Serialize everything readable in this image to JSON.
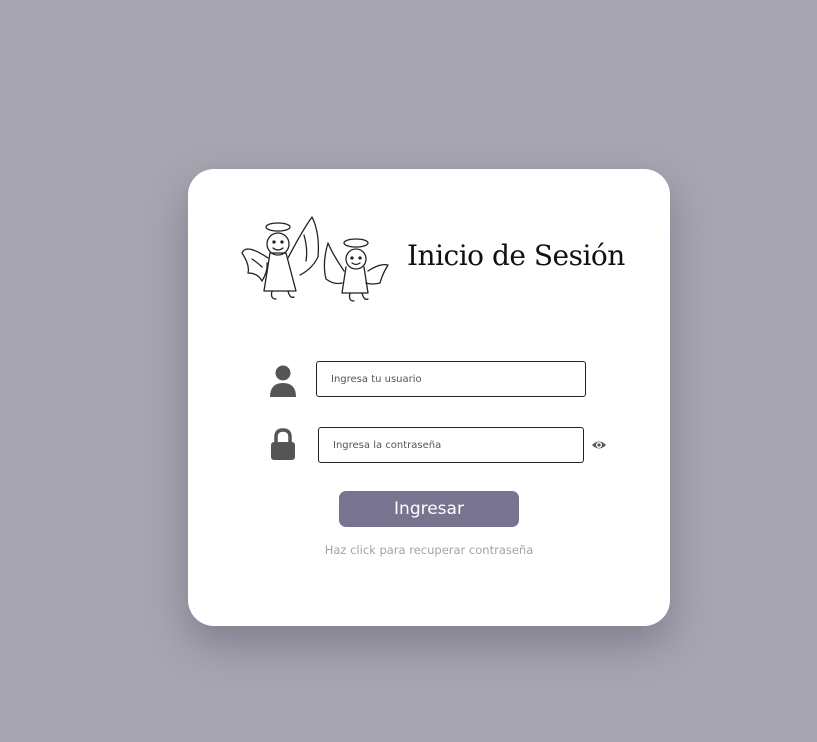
{
  "login": {
    "title": "Inicio de Sesión",
    "username_placeholder": "Ingresa tu usuario",
    "password_placeholder": "Ingresa la contraseña",
    "submit_label": "Ingresar",
    "recover_link": "Haz click para recuperar contraseña"
  },
  "icons": {
    "logo": "angels-logo",
    "user": "user-icon",
    "lock": "lock-icon",
    "eye": "eye-icon"
  },
  "colors": {
    "background": "#a6a5b0",
    "card": "#ffffff",
    "button": "#787490",
    "icon": "#555555",
    "link": "#a3a3a8"
  }
}
